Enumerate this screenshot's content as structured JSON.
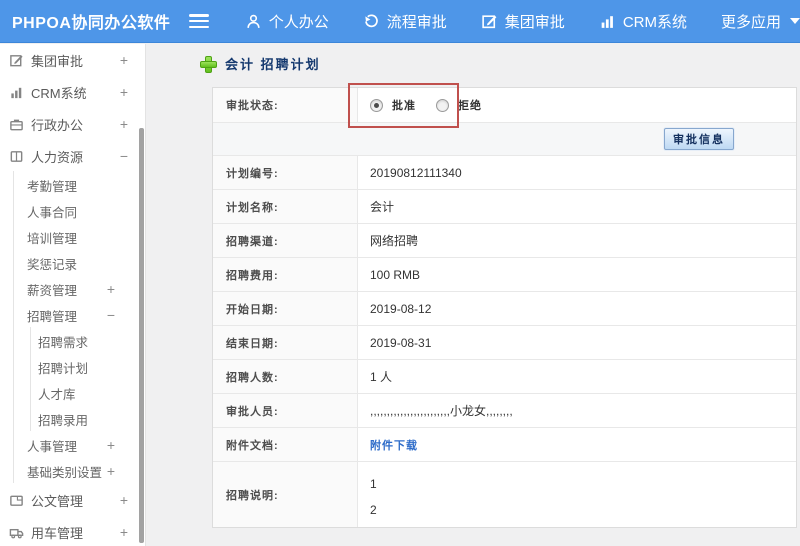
{
  "colors": {
    "topbar_blue": "#4e96e8",
    "highlight_red": "#c0504d",
    "link_blue": "#2e6cc9",
    "title_navy": "#14386e",
    "plus_green": "#62c01e"
  },
  "topbar": {
    "brand": "PHPOA协同办公软件",
    "nav": [
      {
        "label": "个人办公",
        "icon": "person-icon"
      },
      {
        "label": "流程审批",
        "icon": "history-icon"
      },
      {
        "label": "集团审批",
        "icon": "edit-icon"
      },
      {
        "label": "CRM系统",
        "icon": "bar-chart-icon"
      },
      {
        "label": "更多应用",
        "icon": "caret-down-icon"
      }
    ]
  },
  "sidebar": {
    "items": [
      {
        "label": "集团审批",
        "icon": "edit-icon",
        "toggle": "+",
        "level": 0
      },
      {
        "label": "CRM系统",
        "icon": "bar-chart-icon",
        "toggle": "+",
        "level": 0
      },
      {
        "label": "行政办公",
        "icon": "briefcase-icon",
        "toggle": "+",
        "level": 0
      },
      {
        "label": "人力资源",
        "icon": "book-icon",
        "toggle": "−",
        "level": 0
      },
      {
        "label": "考勤管理",
        "toggle": "",
        "level": 1
      },
      {
        "label": "人事合同",
        "toggle": "",
        "level": 1
      },
      {
        "label": "培训管理",
        "toggle": "",
        "level": 1
      },
      {
        "label": "奖惩记录",
        "toggle": "",
        "level": 1
      },
      {
        "label": "薪资管理",
        "toggle": "+",
        "level": 1
      },
      {
        "label": "招聘管理",
        "toggle": "−",
        "level": 1
      },
      {
        "label": "招聘需求",
        "toggle": "",
        "level": 2
      },
      {
        "label": "招聘计划",
        "toggle": "",
        "level": 2
      },
      {
        "label": "人才库",
        "toggle": "",
        "level": 2
      },
      {
        "label": "招聘录用",
        "toggle": "",
        "level": 2
      },
      {
        "label": "人事管理",
        "toggle": "+",
        "level": 1
      },
      {
        "label": "基础类别设置",
        "toggle": "+",
        "level": 1
      },
      {
        "label": "公文管理",
        "icon": "document-icon",
        "toggle": "+",
        "level": 0
      },
      {
        "label": "用车管理",
        "icon": "truck-icon",
        "toggle": "+",
        "level": 0
      }
    ]
  },
  "main": {
    "title": "会计 招聘计划",
    "status_row": {
      "label": "审批状态:",
      "options": [
        {
          "label": "批准",
          "checked": true
        },
        {
          "label": "拒绝",
          "checked": false
        }
      ]
    },
    "approve_button": "审批信息",
    "rows": [
      {
        "label": "计划编号:",
        "value": "20190812111340",
        "type": "text"
      },
      {
        "label": "计划名称:",
        "value": "会计",
        "type": "text"
      },
      {
        "label": "招聘渠道:",
        "value": "网络招聘",
        "type": "text"
      },
      {
        "label": "招聘费用:",
        "value": "100 RMB",
        "type": "text"
      },
      {
        "label": "开始日期:",
        "value": "2019-08-12",
        "type": "text"
      },
      {
        "label": "结束日期:",
        "value": "2019-08-31",
        "type": "text"
      },
      {
        "label": "招聘人数:",
        "value": "1 人",
        "type": "text"
      },
      {
        "label": "审批人员:",
        "value": ",,,,,,,,,,,,,,,,,,,,,,,,小龙女,,,,,,,,",
        "type": "text"
      },
      {
        "label": "附件文档:",
        "value": "附件下载",
        "type": "link"
      },
      {
        "label": "招聘说明:",
        "value": "1\n2",
        "type": "multiline",
        "lines": [
          "1",
          "2"
        ]
      }
    ]
  }
}
